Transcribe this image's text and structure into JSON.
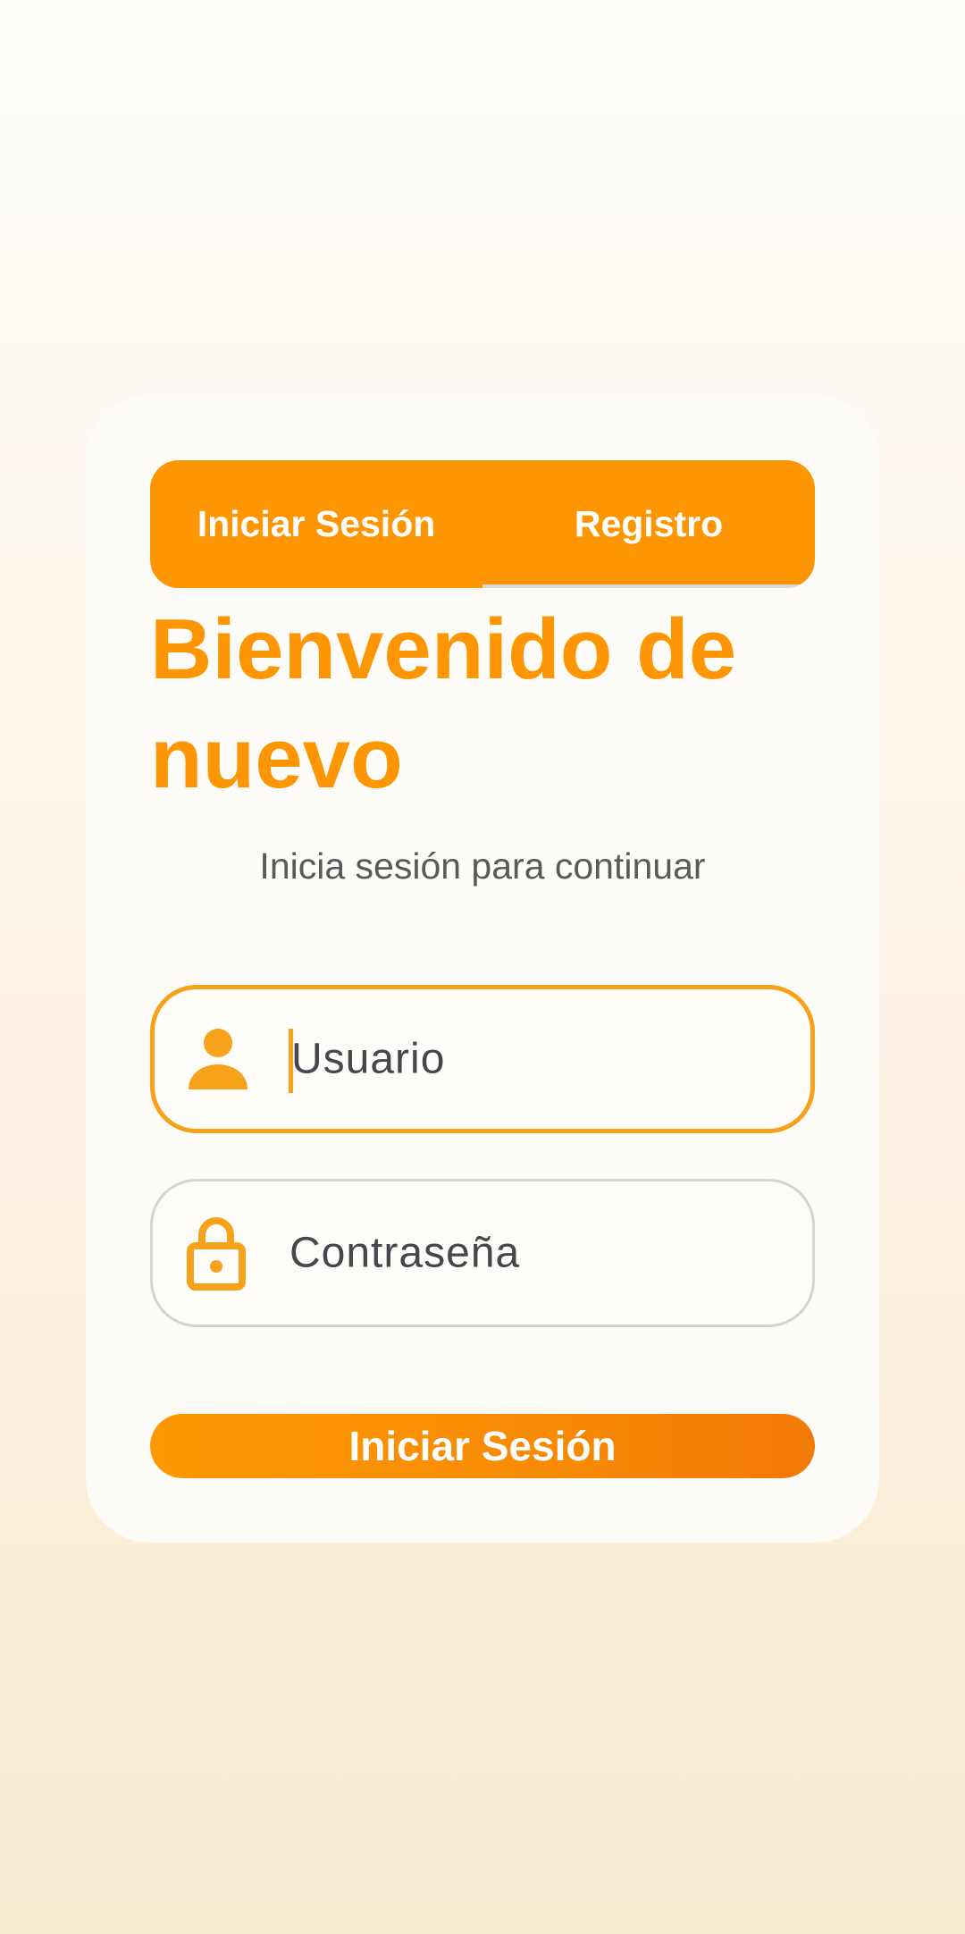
{
  "tabs": {
    "login_label": "Iniciar Sesión",
    "register_label": "Registro"
  },
  "header": {
    "title": "Bienvenido de nuevo",
    "subtitle": "Inicia sesión para continuar"
  },
  "form": {
    "username": {
      "value": "Usuario",
      "icon": "person-icon",
      "state": "focused"
    },
    "password": {
      "value": "Contraseña",
      "icon": "lock-icon"
    },
    "submit_label": "Iniciar Sesión"
  },
  "colors": {
    "accent": "#fd9602",
    "focus_border": "#f6a21a",
    "input_text": "#48454d",
    "subtitle": "#5a5a5a"
  }
}
